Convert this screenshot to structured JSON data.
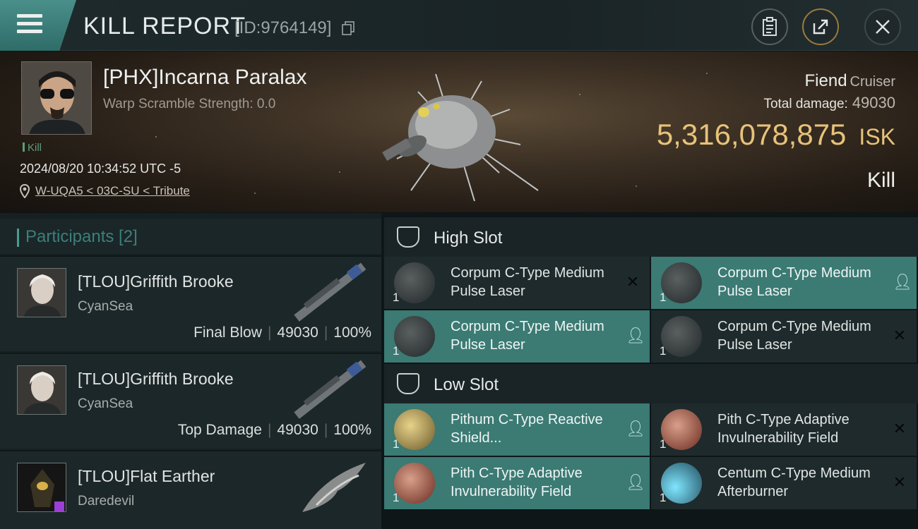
{
  "header": {
    "title": "KILL REPORT",
    "report_id": "[ID:9764149]"
  },
  "victim": {
    "name": "[PHX]Incarna Paralax",
    "subtitle": "Warp Scramble Strength: 0.0",
    "kill_tag": "Kill",
    "datetime": "2024/08/20 10:34:52 UTC -5",
    "location": "W-UQA5 < 03C-SU < Tribute",
    "ship_name": "Fiend",
    "ship_class": "Cruiser",
    "total_damage_label": "Total damage:",
    "total_damage": "49030",
    "isk_value": "5,316,078,875",
    "isk_unit": "ISK",
    "outcome": "Kill"
  },
  "participants": {
    "title": "Participants [2]",
    "rows": [
      {
        "name": "[TLOU]Griffith Brooke",
        "ship": "CyanSea",
        "role": "Final Blow",
        "damage": "49030",
        "percent": "100%"
      },
      {
        "name": "[TLOU]Griffith Brooke",
        "ship": "CyanSea",
        "role": "Top Damage",
        "damage": "49030",
        "percent": "100%"
      },
      {
        "name": "[TLOU]Flat Earther",
        "ship": "Daredevil"
      }
    ]
  },
  "high_slot": {
    "title": "High Slot",
    "modules": [
      {
        "qty": "1",
        "name": "Corpum C-Type Medium Pulse Laser",
        "status": "destroyed"
      },
      {
        "qty": "1",
        "name": "Corpum C-Type Medium Pulse Laser",
        "status": "dropped"
      },
      {
        "qty": "1",
        "name": "Corpum C-Type Medium Pulse Laser",
        "status": "dropped"
      },
      {
        "qty": "1",
        "name": "Corpum C-Type Medium Pulse Laser",
        "status": "destroyed"
      }
    ]
  },
  "low_slot": {
    "title": "Low Slot",
    "modules": [
      {
        "qty": "1",
        "name": "Pithum C-Type Reactive Shield...",
        "status": "dropped"
      },
      {
        "qty": "1",
        "name": "Pith C-Type Adaptive Invulnerability Field",
        "status": "destroyed"
      },
      {
        "qty": "1",
        "name": "Pith C-Type Adaptive Invulnerability Field",
        "status": "dropped"
      },
      {
        "qty": "1",
        "name": "Centum C-Type Medium Afterburner",
        "status": "destroyed"
      }
    ]
  },
  "colors": {
    "accent_teal": "#3c7a74",
    "isk_gold": "#e7c27a"
  },
  "icons": [
    "menu-icon",
    "clipboard-icon",
    "share-icon",
    "close-icon",
    "copy-icon",
    "location-pin-icon",
    "slot-icon",
    "pilot-icon",
    "x-icon"
  ]
}
